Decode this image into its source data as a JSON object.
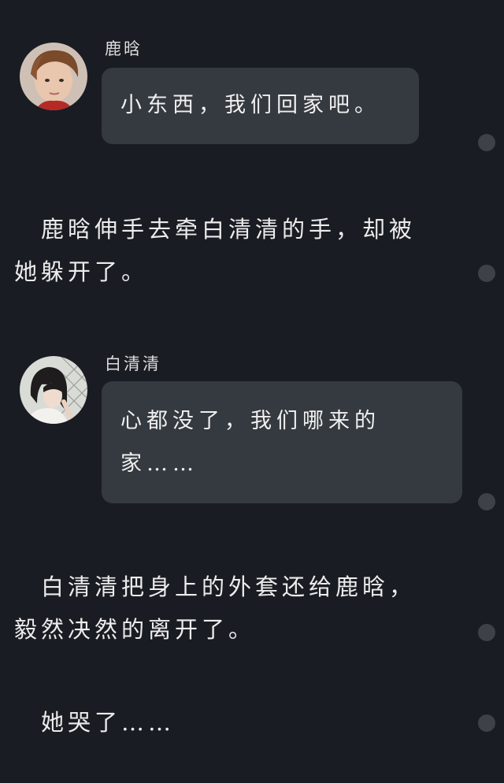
{
  "messages": [
    {
      "sender": "鹿晗",
      "text": "小东西，我们回家吧。",
      "avatar_icon": "boy-portrait-avatar"
    },
    {
      "sender": "白清清",
      "text_lines": [
        "心都没了，我们哪来的",
        "家……"
      ],
      "avatar_icon": "girl-portrait-avatar"
    }
  ],
  "narrations": [
    {
      "lines": [
        "　鹿晗伸手去牵白清清的手，却被",
        "她躲开了。"
      ]
    },
    {
      "lines": [
        "　白清清把身上的外套还给鹿晗，",
        "毅然决然的离开了。"
      ]
    },
    {
      "lines": [
        "　她哭了……"
      ]
    }
  ],
  "colors": {
    "background": "#1a1c23",
    "bubble": "#353a40",
    "text": "#ececec",
    "scroll_marker": "#3e4148"
  }
}
